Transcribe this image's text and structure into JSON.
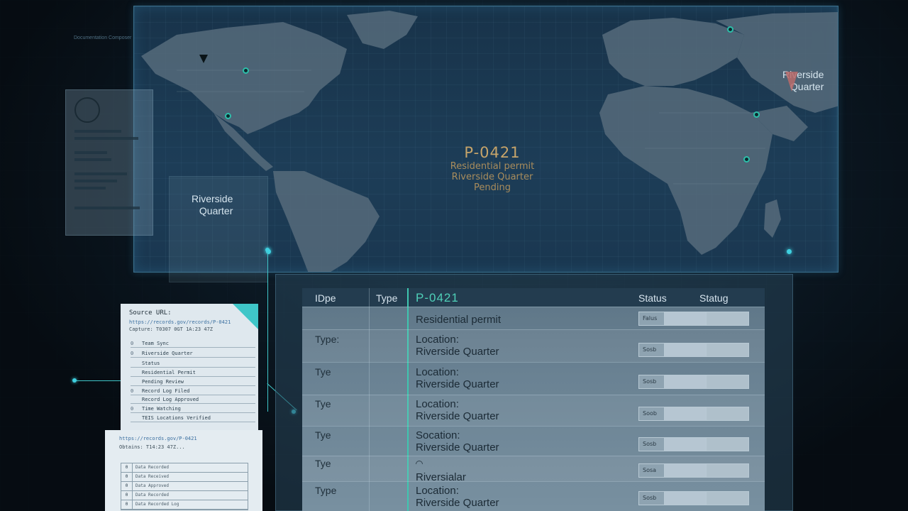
{
  "background": {
    "faint_label": "Documentation Composer"
  },
  "map": {
    "center_card": {
      "id": "P-0421",
      "line1": "Residential permit",
      "line2": "Riverside Quarter",
      "line3": "Pending"
    },
    "label_left": {
      "line1": "Riverside",
      "line2": "Quarter"
    },
    "label_right": {
      "line1": "Riverside",
      "line2": "Quarter"
    },
    "colors": {
      "accent": "#3fd0e0",
      "land": "#5a6f7f",
      "ocean": "#1b3a52",
      "center_text": "#c6a46a"
    }
  },
  "source_card": {
    "title": "Source URL:",
    "url": "https://records.gov/records/P-0421",
    "timestamp": "Capture: T0307 0GT 1A:23 47Z",
    "rows": [
      {
        "n": "0",
        "text": "Team Sync"
      },
      {
        "n": "0",
        "text": "Riverside Quarter"
      },
      {
        "n": "",
        "text": "Status"
      },
      {
        "n": "",
        "text": "Residential Permit"
      },
      {
        "n": "",
        "text": "Pending Review"
      },
      {
        "n": "0",
        "text": "Record Log Filed"
      },
      {
        "n": "",
        "text": "Record Log Approved"
      },
      {
        "n": "0",
        "text": "Time Watching"
      },
      {
        "n": "",
        "text": "TEIS Locations Verified"
      }
    ]
  },
  "source_card2": {
    "url": "https://records.gov/P-0421",
    "timestamp": "Obtains: T14:23 47Z...",
    "rows": [
      {
        "n": "0",
        "text": "Data Recorded"
      },
      {
        "n": "0",
        "text": "Data Received"
      },
      {
        "n": "0",
        "text": "Data Approved"
      },
      {
        "n": "0",
        "text": "Data Recorded"
      },
      {
        "n": "0",
        "text": "Data Recorded Log"
      }
    ]
  },
  "table": {
    "headers": {
      "col1": "IDpe",
      "col2": "Type",
      "id": "P-0421",
      "status1": "Status",
      "status2": "Statug"
    },
    "rows": [
      {
        "label": "",
        "main1": "Residential permit",
        "main2": "",
        "status": "Falus"
      },
      {
        "label": "Type:",
        "main1": "Location:",
        "main2": "Riverside Quarter",
        "status": "Sosb"
      },
      {
        "label": "Tye",
        "main1": "Location:",
        "main2": "Riverside Quarter",
        "status": "Sosb"
      },
      {
        "label": "Tye",
        "main1": "Location:",
        "main2": "Riverside Quarter",
        "status": "Soob"
      },
      {
        "label": "Tye",
        "main1": "Socation:",
        "main2": "Riverside Quarter",
        "status": "Sosb"
      },
      {
        "label": "Tye",
        "main1": "",
        "main2": "Riversialar",
        "status": "Sosa"
      },
      {
        "label": "Type",
        "main1": "Location:",
        "main2": "Riverside Quarter",
        "status": "Sosb"
      }
    ]
  }
}
